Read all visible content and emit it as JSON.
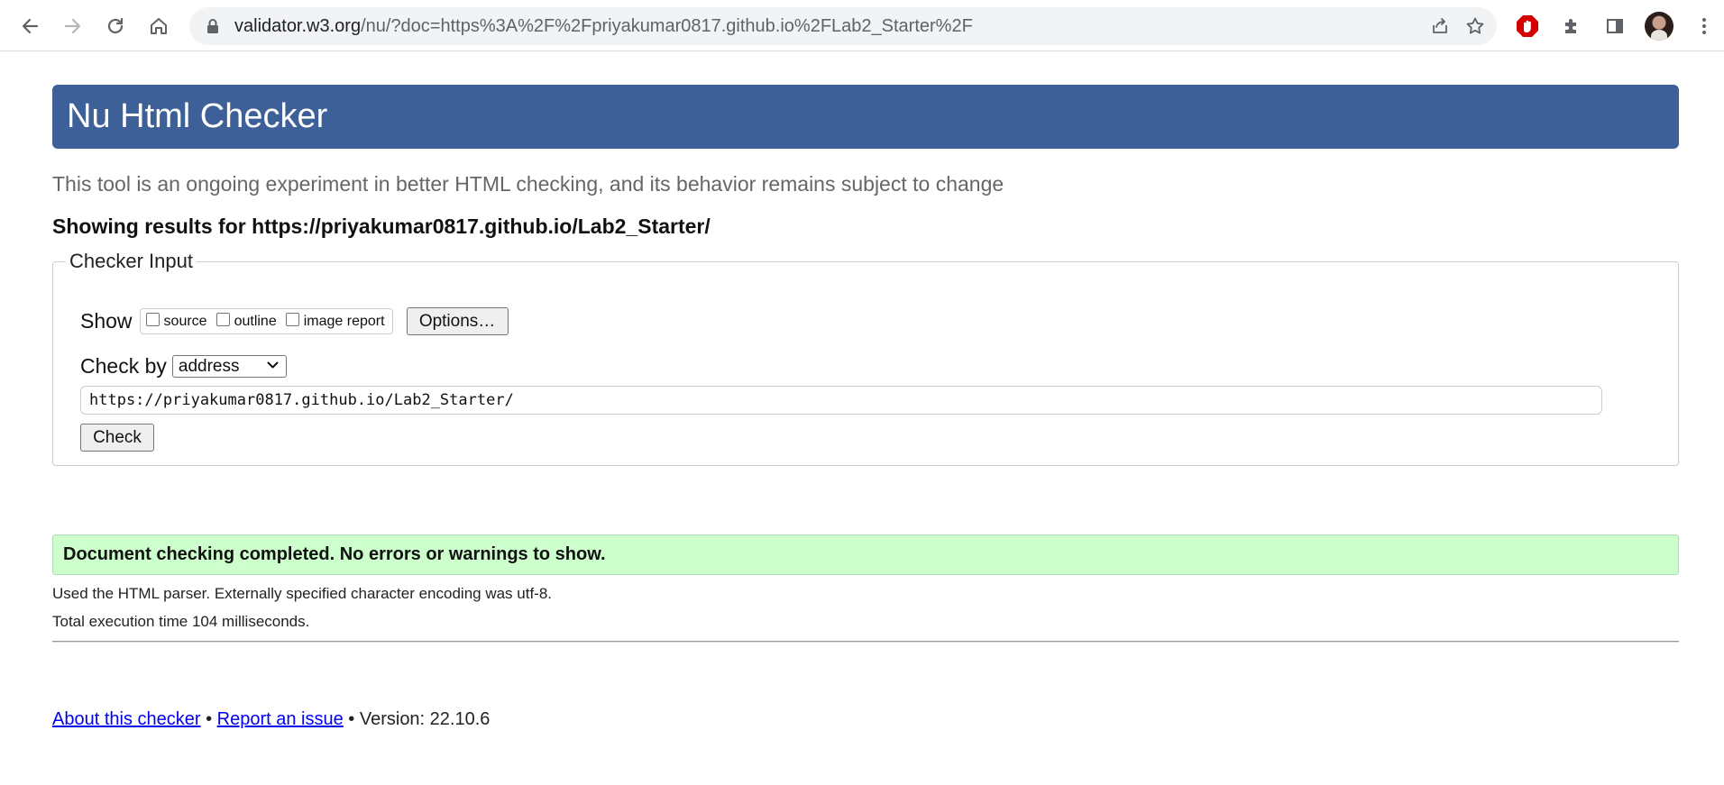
{
  "browser": {
    "url_host": "validator.w3.org",
    "url_rest": "/nu/?doc=https%3A%2F%2Fpriyakumar0817.github.io%2FLab2_Starter%2F",
    "icons": [
      "back-icon",
      "forward-icon",
      "reload-icon",
      "home-icon",
      "lock-icon",
      "share-icon",
      "bookmark-star-icon",
      "adblock-icon",
      "extensions-icon",
      "side-panel-icon",
      "profile-avatar",
      "menu-dots-icon"
    ]
  },
  "page": {
    "banner_title": "Nu Html Checker",
    "subtitle": "This tool is an ongoing experiment in better HTML checking, and its behavior remains subject to change",
    "results_for": "Showing results for https://priyakumar0817.github.io/Lab2_Starter/",
    "checker": {
      "legend": "Checker Input",
      "show_label": "Show",
      "options": [
        {
          "label": "source",
          "checked": false
        },
        {
          "label": "outline",
          "checked": false
        },
        {
          "label": "image report",
          "checked": false
        }
      ],
      "options_button": "Options…",
      "check_by_label": "Check by",
      "check_by_value": "address",
      "url_value": "https://priyakumar0817.github.io/Lab2_Starter/",
      "check_button": "Check"
    },
    "success_message": "Document checking completed. No errors or warnings to show.",
    "parser_info": "Used the HTML parser. Externally specified character encoding was utf-8.",
    "execution_time": "Total execution time 104 milliseconds.",
    "footer": {
      "about_link": "About this checker",
      "separator1": " • ",
      "report_link": "Report an issue",
      "version_text": " • Version: 22.10.6"
    }
  },
  "colors": {
    "banner": "#3e6098",
    "success_bg": "#ccffcc",
    "link": "#0000ee",
    "adblock_red": "#d40000"
  }
}
